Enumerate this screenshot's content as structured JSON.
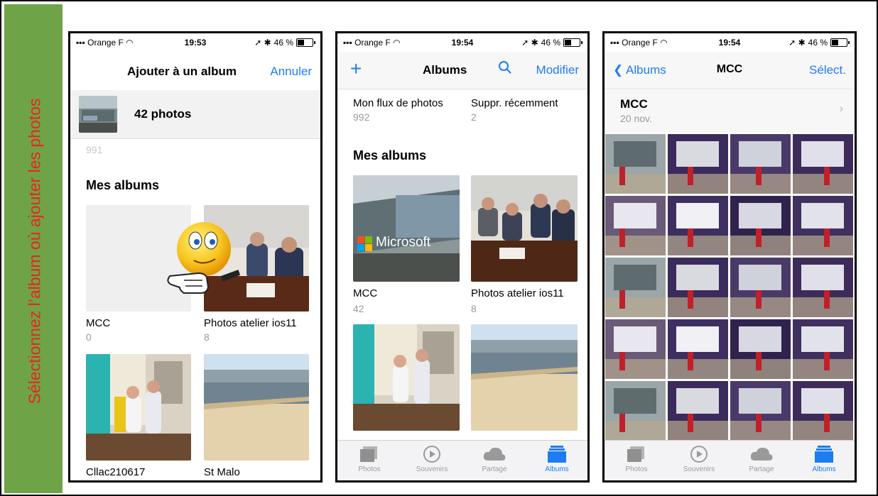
{
  "sidebar": {
    "text": "Sélectionnez l’album où ajouter les photos"
  },
  "status": [
    {
      "carrier": "Orange F",
      "time": "19:53",
      "battery": "46 %"
    },
    {
      "carrier": "Orange F",
      "time": "19:54",
      "battery": "46 %"
    },
    {
      "carrier": "Orange F",
      "time": "19:54",
      "battery": "46 %"
    }
  ],
  "screen1": {
    "title": "Ajouter à un album",
    "cancel": "Annuler",
    "photo_count": "42 photos",
    "faded_count": "991",
    "section": "Mes albums",
    "albums": [
      {
        "name": "MCC",
        "count": "0"
      },
      {
        "name": "Photos atelier ios11",
        "count": "8"
      },
      {
        "name": "Cllac210617",
        "count": ""
      },
      {
        "name": "St Malo",
        "count": ""
      }
    ]
  },
  "screen2": {
    "add": "+",
    "title": "Albums",
    "edit": "Modifier",
    "top_albums": [
      {
        "name": "Mon flux de photos",
        "count": "992"
      },
      {
        "name": "Suppr. récemment",
        "count": "2"
      }
    ],
    "section": "Mes albums",
    "albums": [
      {
        "name": "MCC",
        "count": "42"
      },
      {
        "name": "Photos atelier ios11",
        "count": "8"
      }
    ],
    "microsoft_text": "Microsoft"
  },
  "screen3": {
    "back": "Albums",
    "title": "MCC",
    "select": "Sélect.",
    "album_title": "MCC",
    "album_date": "20 nov."
  },
  "tabs": [
    {
      "label": "Photos",
      "icon": "photos-icon"
    },
    {
      "label": "Souvenirs",
      "icon": "memories-icon"
    },
    {
      "label": "Partage",
      "icon": "cloud-icon"
    },
    {
      "label": "Albums",
      "icon": "albums-icon"
    }
  ],
  "colors": {
    "accent": "#1e7cf1",
    "sidebar": "#6ea447",
    "sidebar_text": "#e8251f"
  }
}
